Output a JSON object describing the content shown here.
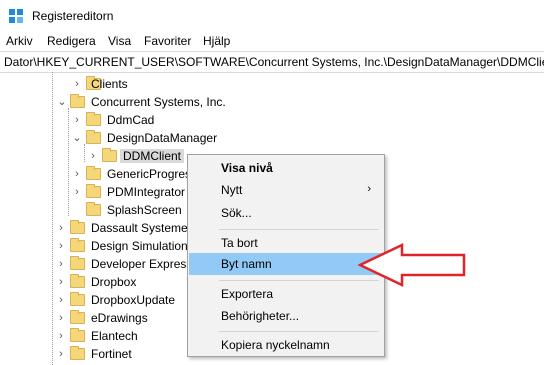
{
  "window": {
    "title": "Registereditorn"
  },
  "menu": {
    "items": [
      "Arkiv",
      "Redigera",
      "Visa",
      "Favoriter",
      "Hjälp"
    ]
  },
  "address": {
    "path": "Dator\\HKEY_CURRENT_USER\\SOFTWARE\\Concurrent Systems, Inc.\\DesignDataManager\\DDMClient"
  },
  "tree": {
    "clients": "Clients",
    "concurrent": "Concurrent Systems, Inc.",
    "ddmcad": "DdmCad",
    "designdatamanager": "DesignDataManager",
    "ddmclient": "DDMClient",
    "genericprogress": "GenericProgres",
    "pdmintegrator": "PDMIntegrator",
    "splashscreen": "SplashScreen",
    "dassault": "Dassault Systemes",
    "designsim": "Design Simulation",
    "developer": "Developer Express",
    "dropbox": "Dropbox",
    "dropboxupdate": "DropboxUpdate",
    "edrawings": "eDrawings",
    "elantech": "Elantech",
    "fortinet": "Fortinet"
  },
  "context_menu": {
    "expand": "Visa nivå",
    "new": "Nytt",
    "find": "Sök...",
    "delete": "Ta bort",
    "rename": "Byt namn",
    "export": "Exportera",
    "permissions": "Behörigheter...",
    "copy_key": "Kopiera nyckelnamn"
  },
  "colors": {
    "hover": "#91c9f7",
    "callout_arrow": "#e0242a",
    "folder": "#f5d77a"
  }
}
